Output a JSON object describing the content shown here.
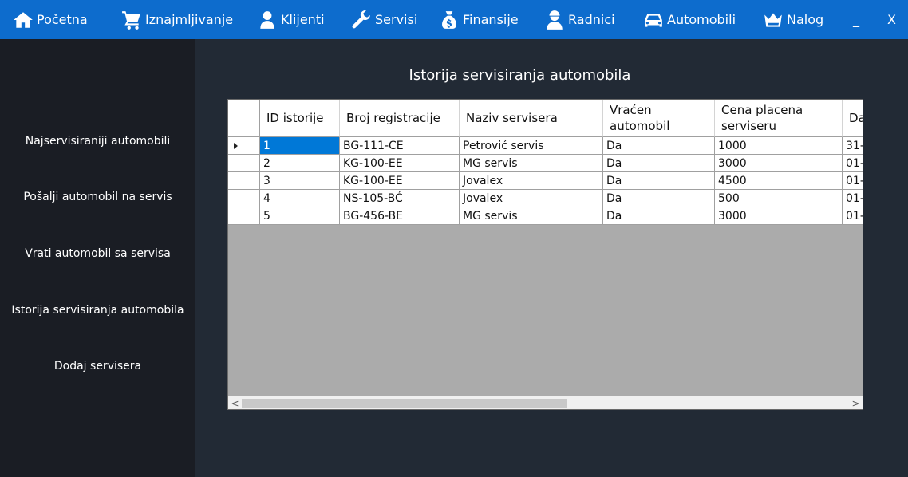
{
  "nav": {
    "items": [
      {
        "label": "Početna",
        "icon": "home-icon"
      },
      {
        "label": "Iznajmljivanje",
        "icon": "cart-icon"
      },
      {
        "label": "Klijenti",
        "icon": "user-icon"
      },
      {
        "label": "Servisi",
        "icon": "wrench-icon"
      },
      {
        "label": "Finansije",
        "icon": "money-bag-icon"
      },
      {
        "label": "Radnici",
        "icon": "worker-icon"
      },
      {
        "label": "Automobili",
        "icon": "car-icon"
      },
      {
        "label": "Nalog",
        "icon": "crown-icon"
      }
    ],
    "minimize": "_",
    "close": "X"
  },
  "sidebar": {
    "items": [
      {
        "label": "Najservisiraniji automobili"
      },
      {
        "label": "Pošalji automobil na servis"
      },
      {
        "label": "Vrati automobil sa servisa"
      },
      {
        "label": "Istorija servisiranja automobila"
      },
      {
        "label": "Dodaj servisera"
      }
    ]
  },
  "main": {
    "title": "Istorija servisiranja automobila"
  },
  "grid": {
    "columns": [
      "ID istorije",
      "Broj registracije",
      "Naziv servisera",
      "Vraćen automobil",
      "Cena placena serviseru",
      "Da"
    ],
    "rows": [
      [
        "1",
        "BG-111-CE",
        "Petrović servis",
        "Da",
        "1000",
        "31-"
      ],
      [
        "2",
        "KG-100-EE",
        "MG servis",
        "Da",
        "3000",
        "01-"
      ],
      [
        "3",
        "KG-100-EE",
        "Jovalex",
        "Da",
        "4500",
        "01-"
      ],
      [
        "4",
        "NS-105-BĆ",
        "Jovalex",
        "Da",
        "500",
        "01-"
      ],
      [
        "5",
        "BG-456-BE",
        "MG servis",
        "Da",
        "3000",
        "01-"
      ]
    ],
    "scroll_left": "<",
    "scroll_right": ">"
  }
}
